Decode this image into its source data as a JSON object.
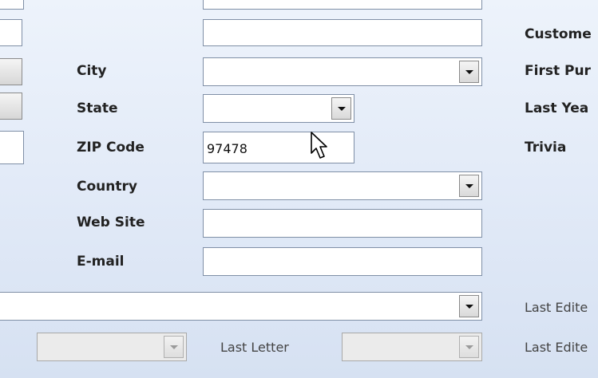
{
  "labels": {
    "city": "City",
    "state": "State",
    "zip": "ZIP Code",
    "country": "Country",
    "web_site": "Web Site",
    "email": "E-mail",
    "last_letter": "Last Letter"
  },
  "right_labels": {
    "customer": "Custome",
    "first_purchase": "First Pur",
    "last_year": "Last Yea",
    "trivia": "Trivia",
    "last_edited_1": "Last Edite",
    "last_edited_2": "Last Edite"
  },
  "fields": {
    "top_partial": "",
    "address2": "",
    "city": "",
    "state": "",
    "zip": "97478",
    "country": "",
    "web_site": "",
    "email": "",
    "wide_combo": "",
    "bottom_left_combo": "",
    "last_letter": ""
  },
  "icons": {
    "dropdown": "chevron-down-icon",
    "cursor": "mouse-pointer-icon"
  }
}
